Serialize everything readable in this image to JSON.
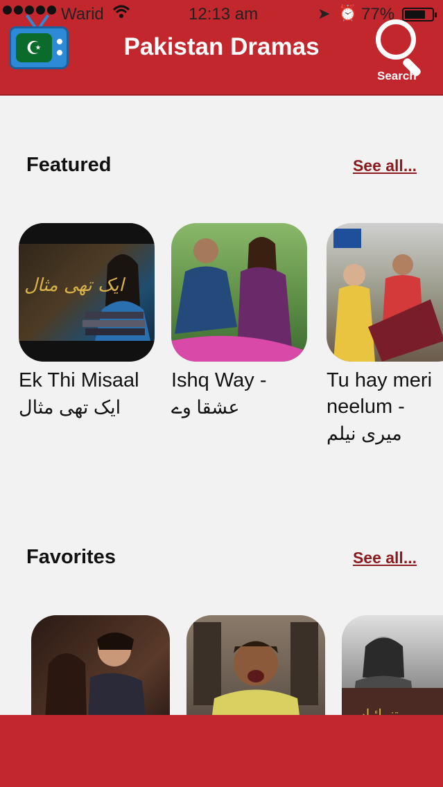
{
  "status_bar": {
    "carrier": "Warid",
    "time": "12:13 am",
    "battery": "77%",
    "battery_level": 0.77
  },
  "header": {
    "title": "Pakistan Dramas",
    "search_label": "Search"
  },
  "featured": {
    "title": "Featured",
    "see_all": "See all...",
    "items": [
      {
        "name": "Ek Thi Misaal",
        "urdu": "ایک تھی مثال"
      },
      {
        "name": "Ishq Way -",
        "urdu": "عشقا وے"
      },
      {
        "name": "Tu hay meri neelum -",
        "urdu": "میری نیلم"
      }
    ]
  },
  "favorites": {
    "title": "Favorites",
    "see_all": "See all...",
    "items": [
      {
        "name": ""
      },
      {
        "name": ""
      },
      {
        "name": ""
      }
    ]
  },
  "colors": {
    "brand_red": "#c1272d",
    "link_red": "#8b1a1f",
    "background": "#f2f2f2"
  }
}
